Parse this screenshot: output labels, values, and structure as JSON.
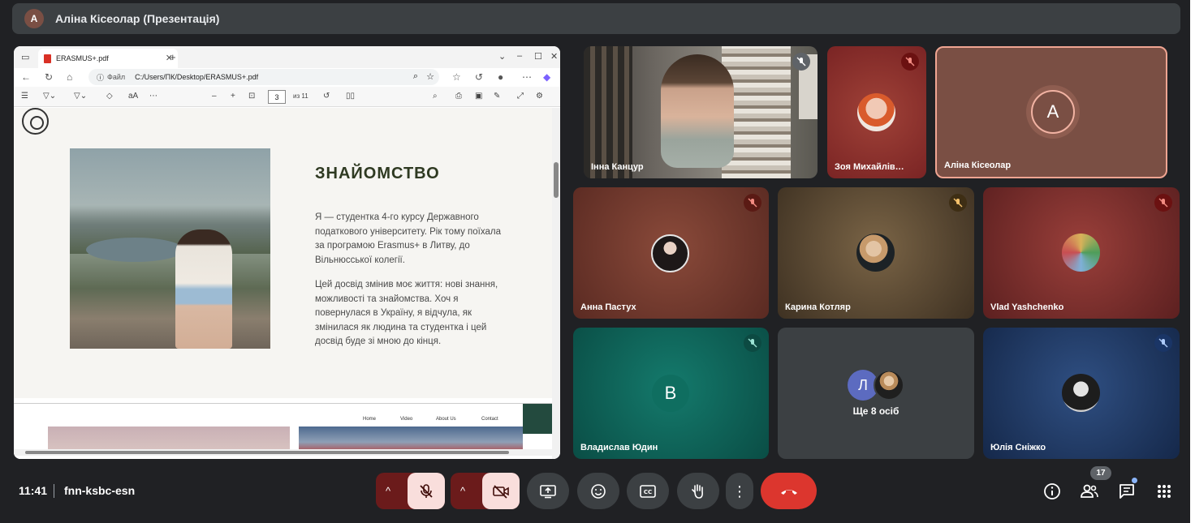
{
  "presenter_bar": {
    "avatar_letter": "A",
    "title": "Аліна Кісеолар (Презентація)"
  },
  "browser": {
    "tab_title": "ERASMUS+.pdf",
    "address_prefix": "Файл",
    "address": "C:/Users/ПК/Desktop/ERASMUS+.pdf",
    "page_number": "3",
    "page_count": "из 11"
  },
  "slide": {
    "heading": "ЗНАЙОМСТВО",
    "paragraph1": "Я — студентка 4-го курсу Державного податкового університету. Рік тому поїхала за програмою Erasmus+ в Литву, до Вільнюсської колегії.",
    "paragraph2": "Цей досвід змінив моє життя: нові знання, можливості та знайомства. Хоч я повернулася в Україну, я відчула, як змінилася як людина та студентка і цей досвід буде зі мною до кінця.",
    "next_nav": [
      "Home",
      "Video",
      "About Us",
      "Contact"
    ]
  },
  "participants": [
    {
      "name": "Інна Канцур",
      "muted": true,
      "bg": "#4a4a4a"
    },
    {
      "name": "Зоя Михайлів…",
      "muted": true,
      "bg": "#8b2a2a"
    },
    {
      "name": "Аліна Кісеолар",
      "muted": false,
      "letter": "A",
      "bg": "#7a4f44"
    },
    {
      "name": "Анна Пастух",
      "muted": true,
      "bg": "#6b3a2e"
    },
    {
      "name": "Карина Котляр",
      "muted": true,
      "bg": "#5a4630"
    },
    {
      "name": "Vlad Yashchenko",
      "muted": true,
      "bg": "#7a3030"
    },
    {
      "name": "Владислав Юдин",
      "muted": true,
      "letter": "В",
      "bg": "#0f5c52"
    },
    {
      "name": "Ще 8 осіб",
      "letter": "Л",
      "bg": "#3c4043"
    },
    {
      "name": "Юлія Сніжко",
      "muted": true,
      "bg": "#1f3a66"
    }
  ],
  "meeting": {
    "time": "11:41",
    "code": "fnn-ksbc-esn",
    "participant_count": "17"
  },
  "colors": {
    "hangup": "#dc362e",
    "muted_control": "#f9dedc",
    "toolbar": "#3c4043"
  }
}
